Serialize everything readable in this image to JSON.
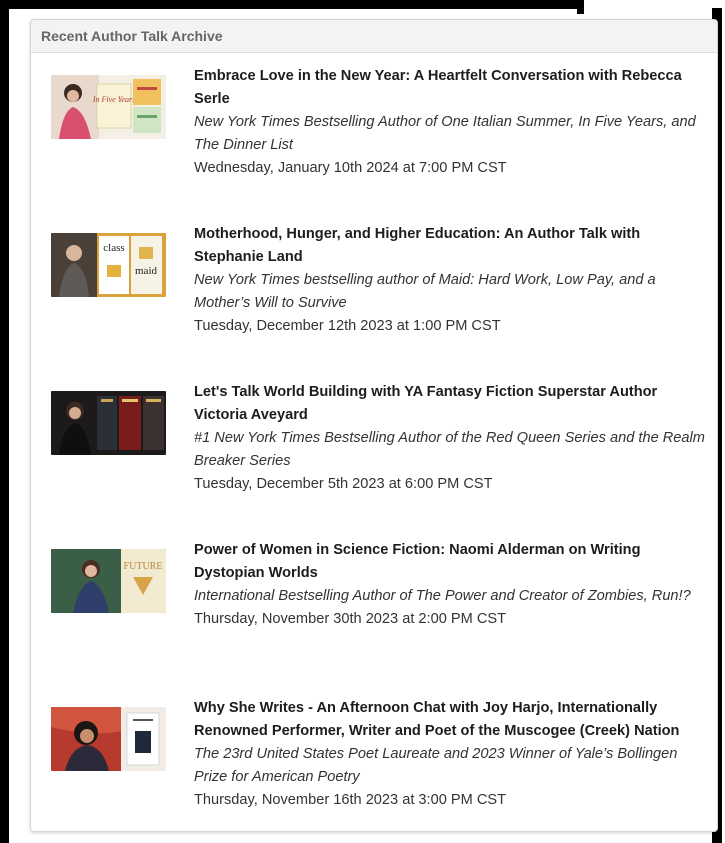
{
  "panel": {
    "header": "Recent Author Talk Archive"
  },
  "events": [
    {
      "title": "Embrace Love in the New Year: A Heartfelt Conversation with Rebecca Serle",
      "subtitle": "New York Times Bestselling Author of One Italian Summer, In Five Years, and The Dinner List",
      "date": "Wednesday, January 10th 2024 at 7:00 PM CST",
      "thumb_caption": "In Five Years"
    },
    {
      "title": "Motherhood, Hunger, and Higher Education: An Author Talk with Stephanie Land",
      "subtitle": "New York Times bestselling author of Maid: Hard Work, Low Pay, and a Mother’s Will to Survive",
      "date": "Tuesday, December 12th 2023 at 1:00 PM CST",
      "thumb_caption_1": "class",
      "thumb_caption_2": "maid"
    },
    {
      "title": "Let's Talk World Building with YA Fantasy Fiction Superstar Author Victoria Aveyard",
      "subtitle": "#1 New York Times Bestselling Author of the Red Queen Series and the Realm Breaker Series",
      "date": "Tuesday, December 5th 2023 at 6:00 PM CST"
    },
    {
      "title": "Power of Women in Science Fiction: Naomi Alderman on Writing Dystopian Worlds",
      "subtitle": "International Bestselling Author of The Power and Creator of Zombies, Run!?",
      "date": "Thursday, November 30th 2023 at 2:00 PM CST",
      "thumb_caption": "FUTURE"
    },
    {
      "title": "Why She Writes - An Afternoon Chat with Joy Harjo, Internationally Renowned Performer, Writer and Poet of the Muscogee (Creek) Nation",
      "subtitle": "The 23rd United States Poet Laureate and 2023 Winner of Yale’s Bollingen Prize for American Poetry",
      "date": "Thursday, November 16th 2023 at 3:00 PM CST"
    }
  ]
}
